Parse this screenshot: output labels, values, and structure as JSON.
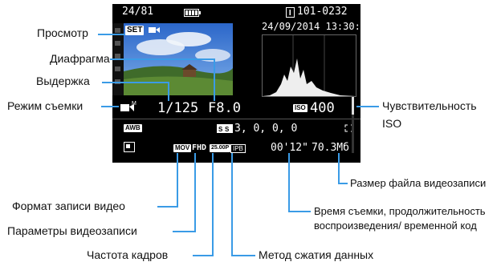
{
  "labels": {
    "playback": "Просмотр",
    "aperture": "Диафрагма",
    "shutter": "Выдержка",
    "shooting_mode": "Режим съемки",
    "iso_line1": "Чувствительность",
    "iso_line2": "ISO",
    "file_size": "Размер файла видеозаписи",
    "time_line1": "Время съемки, продолжительность",
    "time_line2": "воспроизведения/ временной код",
    "record_format": "Формат записи видео",
    "record_params": "Параметры видеозаписи",
    "frame_rate": "Частота кадров",
    "compression": "Метод сжатия данных"
  },
  "screen": {
    "frame_counter": "24/81",
    "file_number": "101-0232",
    "datetime": "24/09/2014 13:30:00",
    "set_badge": "SET",
    "shutter": "1/125",
    "aperture": "F8.0",
    "iso_icon": "ISO",
    "iso": "400",
    "wb": "AWB",
    "picture_style": "3, 0, 0, 0",
    "format_mov": "MOV",
    "format_fhd": "FHD",
    "format_fps": "25.00P",
    "format_ipb": "IPB",
    "rec_time": "00'12\"",
    "file_size": "70.3Мб"
  },
  "icons": [
    "battery-icon",
    "protect-icon",
    "movie-mode-icon",
    "histogram-icon",
    "picture-style-icon",
    "af-frame-icon",
    "alo-off-icon",
    "thumbnail-image",
    "film-strip-icon"
  ],
  "colors": {
    "accent": "#3a9be6",
    "screen_bg": "#000000",
    "text_on_screen": "#ffffff"
  }
}
